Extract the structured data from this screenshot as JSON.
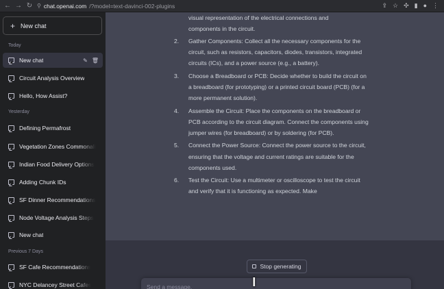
{
  "browser": {
    "url_host": "chat.openai.com",
    "url_path": "/?model=text-davinci-002-plugins"
  },
  "sidebar": {
    "new_chat_label": "New chat",
    "sections": {
      "today": "Today",
      "yesterday": "Yesterday",
      "previous_7_days": "Previous 7 Days"
    },
    "today_items": [
      {
        "label": "New chat",
        "active": true
      },
      {
        "label": "Circuit Analysis Overview"
      },
      {
        "label": "Hello, How Assist?"
      }
    ],
    "yesterday_items": [
      {
        "label": "Defining Permafrost"
      },
      {
        "label": "Vegetation Zones Commonali"
      },
      {
        "label": "Indian Food Delivery Options"
      },
      {
        "label": "Adding Chunk IDs"
      },
      {
        "label": "SF Dinner Recommendations"
      },
      {
        "label": "Node Voltage Analysis Steps"
      },
      {
        "label": "New chat"
      }
    ],
    "previous_items": [
      {
        "label": "SF Cafe Recommendations"
      },
      {
        "label": "NYC Delancey Street Cafes"
      }
    ]
  },
  "answer": {
    "intro_lines": [
      "visual representation of the electrical connections and",
      "components in the circuit."
    ],
    "steps": [
      {
        "num": "2.",
        "text": "Gather Components: Collect all the necessary components for the circuit, such as resistors, capacitors, diodes, transistors, integrated circuits (ICs), and a power source (e.g., a battery)."
      },
      {
        "num": "3.",
        "text": "Choose a Breadboard or PCB: Decide whether to build the circuit on a breadboard (for prototyping) or a printed circuit board (PCB) (for a more permanent solution)."
      },
      {
        "num": "4.",
        "text": "Assemble the Circuit: Place the components on the breadboard or PCB according to the circuit diagram. Connect the components using jumper wires (for breadboard) or by soldering (for PCB)."
      },
      {
        "num": "5.",
        "text": "Connect the Power Source: Connect the power source to the circuit, ensuring that the voltage and current ratings are suitable for the components used."
      },
      {
        "num": "6.",
        "text": "Test the Circuit: Use a multimeter or oscilloscope to test the circuit and verify that it is functioning as expected. Make"
      }
    ]
  },
  "composer": {
    "stop_label": "Stop generating",
    "placeholder": "Send a message."
  }
}
